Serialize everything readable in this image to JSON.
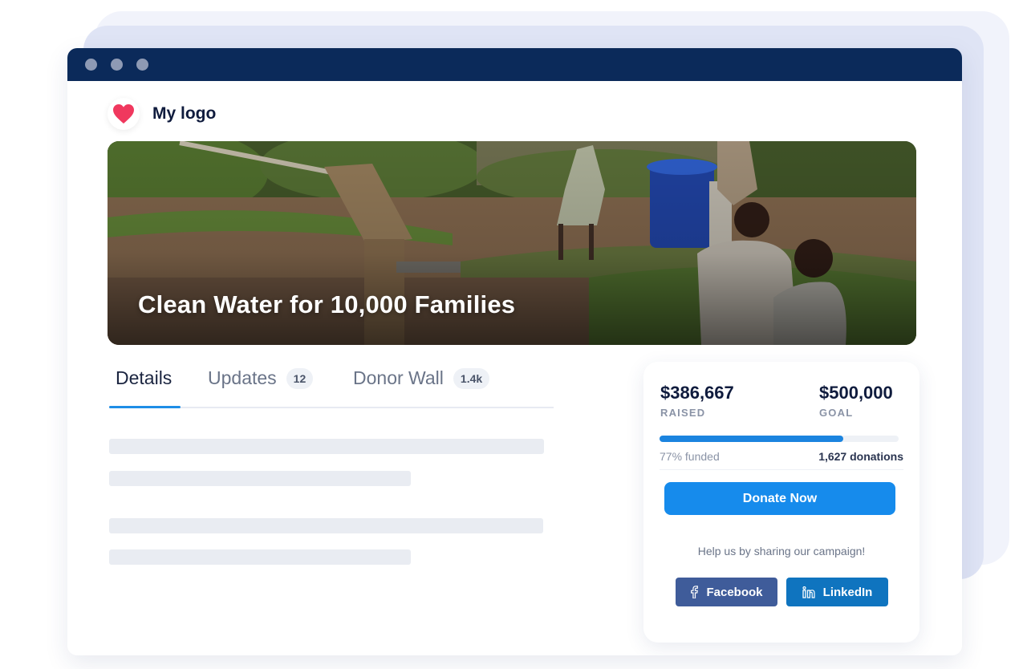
{
  "brand": {
    "logo_text": "My logo",
    "logo_icon": "heart-icon",
    "heart_color": "#f0385e"
  },
  "hero": {
    "title": "Clean Water for 10,000 Families"
  },
  "tabs": [
    {
      "label": "Details",
      "active": true
    },
    {
      "label": "Updates",
      "badge": "12"
    },
    {
      "label": "Donor Wall",
      "badge": "1.4k"
    }
  ],
  "campaign": {
    "raised": "$386,667",
    "raised_label": "RAISED",
    "goal": "$500,000",
    "goal_label": "GOAL",
    "progress_fraction": 0.77,
    "funded_text": "77% funded",
    "donations_text": "1,627 donations",
    "donate_label": "Donate Now",
    "share_text": "Help us by sharing our campaign!",
    "facebook_label": "Facebook",
    "linkedin_label": "LinkedIn"
  },
  "colors": {
    "titlebar": "#0b2a5a",
    "accent": "#168bec",
    "facebook": "#3f5c9a",
    "linkedin": "#0f74bf"
  }
}
